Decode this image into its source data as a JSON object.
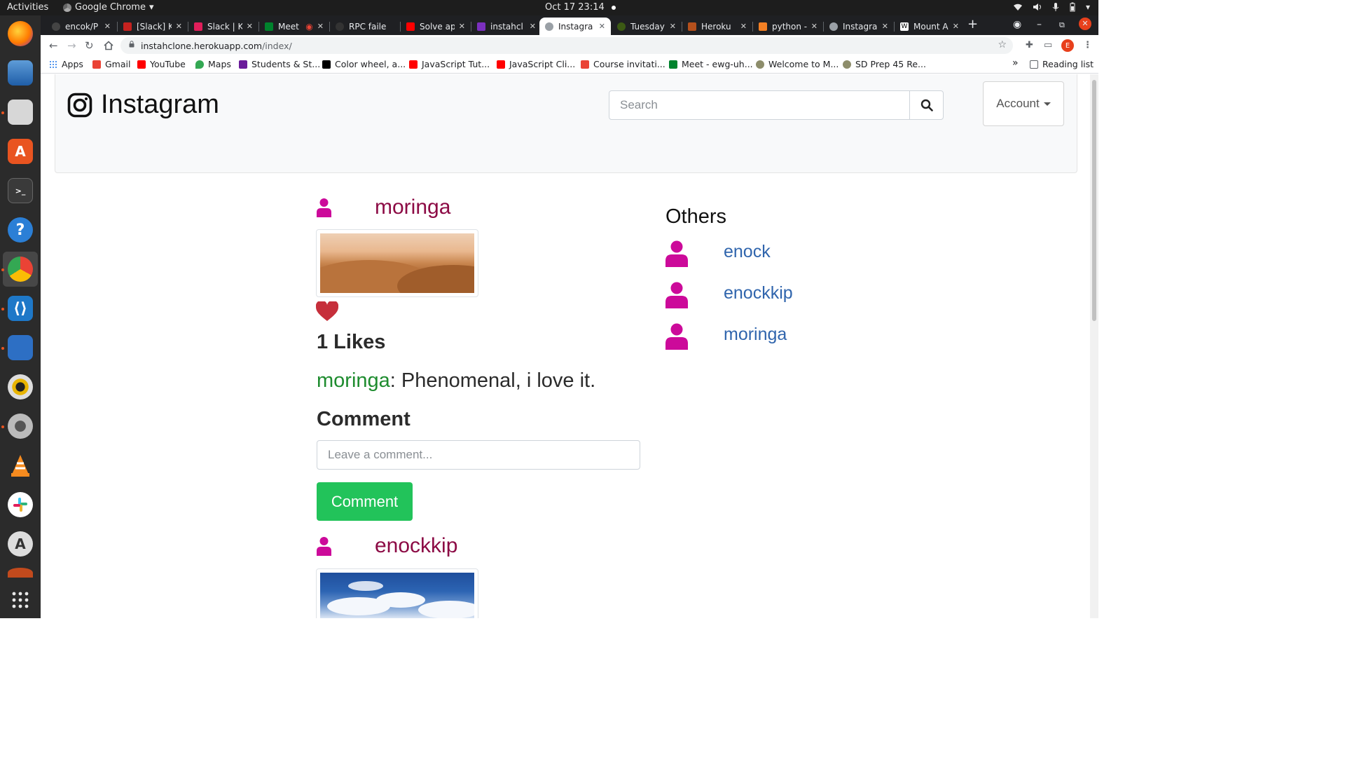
{
  "system": {
    "activities": "Activities",
    "app_name": "Google Chrome",
    "clock": "Oct 17  23:14"
  },
  "browser": {
    "tabs": [
      {
        "title": "encok/P",
        "color": "#444444"
      },
      {
        "title": "[Slack] K",
        "color": "#c5221f"
      },
      {
        "title": "Slack | Ki",
        "color": "#e01e5a"
      },
      {
        "title": "Meet",
        "color": "#00832d"
      },
      {
        "title": "RPC faile",
        "color": "#333333"
      },
      {
        "title": "Solve ap",
        "color": "#ff0000"
      },
      {
        "title": "instahcl",
        "color": "#7b2fbf"
      },
      {
        "title": "Instagra",
        "color": "#5f6368"
      },
      {
        "title": "Tuesday",
        "color": "#3c5a14"
      },
      {
        "title": "Heroku",
        "color": "#b5501c"
      },
      {
        "title": "python -",
        "color": "#f48024"
      },
      {
        "title": "Instagra",
        "color": "#5f6368"
      },
      {
        "title": "Mount A",
        "color": "#ffffff"
      }
    ],
    "active_tab_index": 7,
    "url_host": "instahclone.herokuapp.com",
    "url_path": "/index/",
    "profile_initial": "E",
    "bookmarks": [
      {
        "label": "Apps",
        "color": "#1a73e8"
      },
      {
        "label": "Gmail",
        "color": "#ea4335"
      },
      {
        "label": "YouTube",
        "color": "#ff0000"
      },
      {
        "label": "Maps",
        "color": "#34a853"
      },
      {
        "label": "Students & St...",
        "color": "#6a1b9a"
      },
      {
        "label": "Color wheel, a...",
        "color": "#000000"
      },
      {
        "label": "JavaScript Tut...",
        "color": "#ff0000"
      },
      {
        "label": "JavaScript Cli...",
        "color": "#ff0000"
      },
      {
        "label": "Course invitati...",
        "color": "#ea4335"
      },
      {
        "label": "Meet - ewg-uh...",
        "color": "#00832d"
      },
      {
        "label": "Welcome to M...",
        "color": "#8d8d6b"
      },
      {
        "label": "SD Prep 45 Re...",
        "color": "#8d8d6b"
      }
    ],
    "overflow": "»",
    "reading_list": "Reading list"
  },
  "page": {
    "brand": "Instagram",
    "search_placeholder": "Search",
    "account_label": "Account",
    "posts": [
      {
        "username": "moringa",
        "likes_text": "1 Likes",
        "comment_user": "moringa",
        "comment_text": ": Phenomenal, i love it."
      },
      {
        "username": "enockkip"
      }
    ],
    "comment_heading": "Comment",
    "comment_placeholder": "Leave a comment...",
    "comment_button": "Comment",
    "others_title": "Others",
    "others": [
      "enock",
      "enockkip",
      "moringa"
    ]
  },
  "colors": {
    "username": "#8c0b45",
    "user_icon": "#cc0a9a",
    "link": "#3065ad",
    "comment_user": "#1e8c2f",
    "comment_button": "#22c35a",
    "heart": "#c62f3b"
  }
}
